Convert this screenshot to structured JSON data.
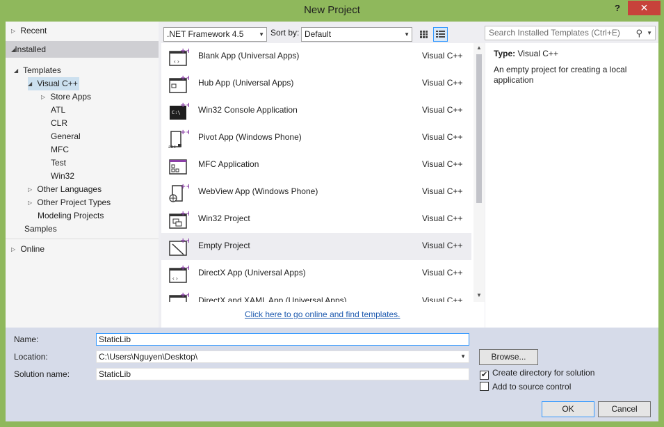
{
  "window": {
    "title": "New Project",
    "help": "?",
    "close": "✕"
  },
  "tree": {
    "recent": "Recent",
    "installed": "Installed",
    "templates": "Templates",
    "visual_cpp": "Visual C++",
    "children": [
      "Store Apps",
      "ATL",
      "CLR",
      "General",
      "MFC",
      "Test",
      "Win32"
    ],
    "other_languages": "Other Languages",
    "other_project_types": "Other Project Types",
    "modeling_projects": "Modeling Projects",
    "samples": "Samples",
    "online": "Online"
  },
  "toolbar": {
    "framework": ".NET Framework 4.5",
    "sort_by_label": "Sort by:",
    "sort_value": "Default",
    "search_placeholder": "Search Installed Templates (Ctrl+E)"
  },
  "templates": [
    {
      "name": "Blank App (Universal Apps)",
      "lang": "Visual C++"
    },
    {
      "name": "Hub App (Universal Apps)",
      "lang": "Visual C++"
    },
    {
      "name": "Win32 Console Application",
      "lang": "Visual C++"
    },
    {
      "name": "Pivot App (Windows Phone)",
      "lang": "Visual C++"
    },
    {
      "name": "MFC Application",
      "lang": "Visual C++"
    },
    {
      "name": "WebView App (Windows Phone)",
      "lang": "Visual C++"
    },
    {
      "name": "Win32 Project",
      "lang": "Visual C++"
    },
    {
      "name": "Empty Project",
      "lang": "Visual C++"
    },
    {
      "name": "DirectX App (Universal Apps)",
      "lang": "Visual C++"
    },
    {
      "name": "DirectX and XAML App (Universal Apps)",
      "lang": "Visual C++"
    }
  ],
  "online_link": "Click here to go online and find templates.",
  "description": {
    "type_label": "Type:",
    "type_value": "Visual C++",
    "text": "An empty project for creating a local application"
  },
  "form": {
    "name_label": "Name:",
    "name_value": "StaticLib",
    "location_label": "Location:",
    "location_value": "C:\\Users\\Nguyen\\Desktop\\",
    "solution_label": "Solution name:",
    "solution_value": "StaticLib",
    "browse": "Browse...",
    "create_dir": "Create directory for solution",
    "create_dir_checked": true,
    "add_source": "Add to source control",
    "add_source_checked": false,
    "ok": "OK",
    "cancel": "Cancel"
  },
  "colors": {
    "frame": "#8fb85c",
    "close": "#c7423b",
    "accent": "#3399ff",
    "link": "#1e5aaf"
  }
}
